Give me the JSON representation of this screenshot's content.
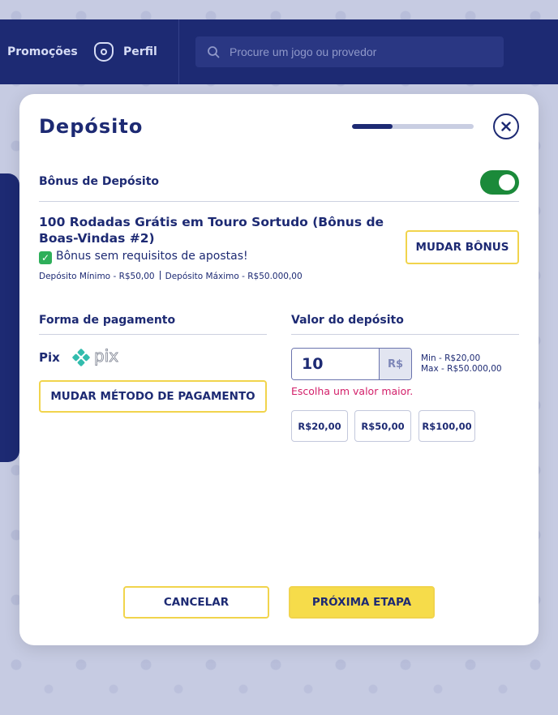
{
  "header": {
    "nav_promocoes": "Promoções",
    "nav_perfil": "Perfil",
    "search_placeholder": "Procure um jogo ou provedor"
  },
  "modal": {
    "title": "Depósito",
    "progress_fraction": 0.33,
    "bonus_toggle_label": "Bônus de Depósito",
    "bonus_toggle_on": true,
    "bonus_title": "100 Rodadas Grátis em Touro Sortudo (Bônus de Boas-Vindas #2)",
    "bonus_subtitle_check": "✓",
    "bonus_subtitle": "Bônus sem requisitos de apostas!",
    "bonus_min": "Depósito Mínimo - R$50,00",
    "bonus_max": "Depósito Máximo - R$50.000,00",
    "change_bonus_button": "MUDAR BÔNUS",
    "payment_section_label": "Forma de pagamento",
    "payment_method": "Pix",
    "payment_logo_text": "pix",
    "change_payment_button": "MUDAR MÉTODO DE PAGAMENTO",
    "amount_section_label": "Valor do depósito",
    "amount_value": "10",
    "currency": "R$",
    "amount_min": "Min - R$20,00",
    "amount_max": "Max - R$50.000,00",
    "amount_error": "Escolha um valor maior.",
    "quick_amounts": [
      "R$20,00",
      "R$50,00",
      "R$100,00"
    ],
    "cancel_button": "CANCELAR",
    "next_button": "PRÓXIMA ETAPA"
  },
  "colors": {
    "primary": "#1d2a73",
    "accent_yellow": "#f6dc4a",
    "toggle_green": "#1b8a3a",
    "error": "#d3206a"
  }
}
